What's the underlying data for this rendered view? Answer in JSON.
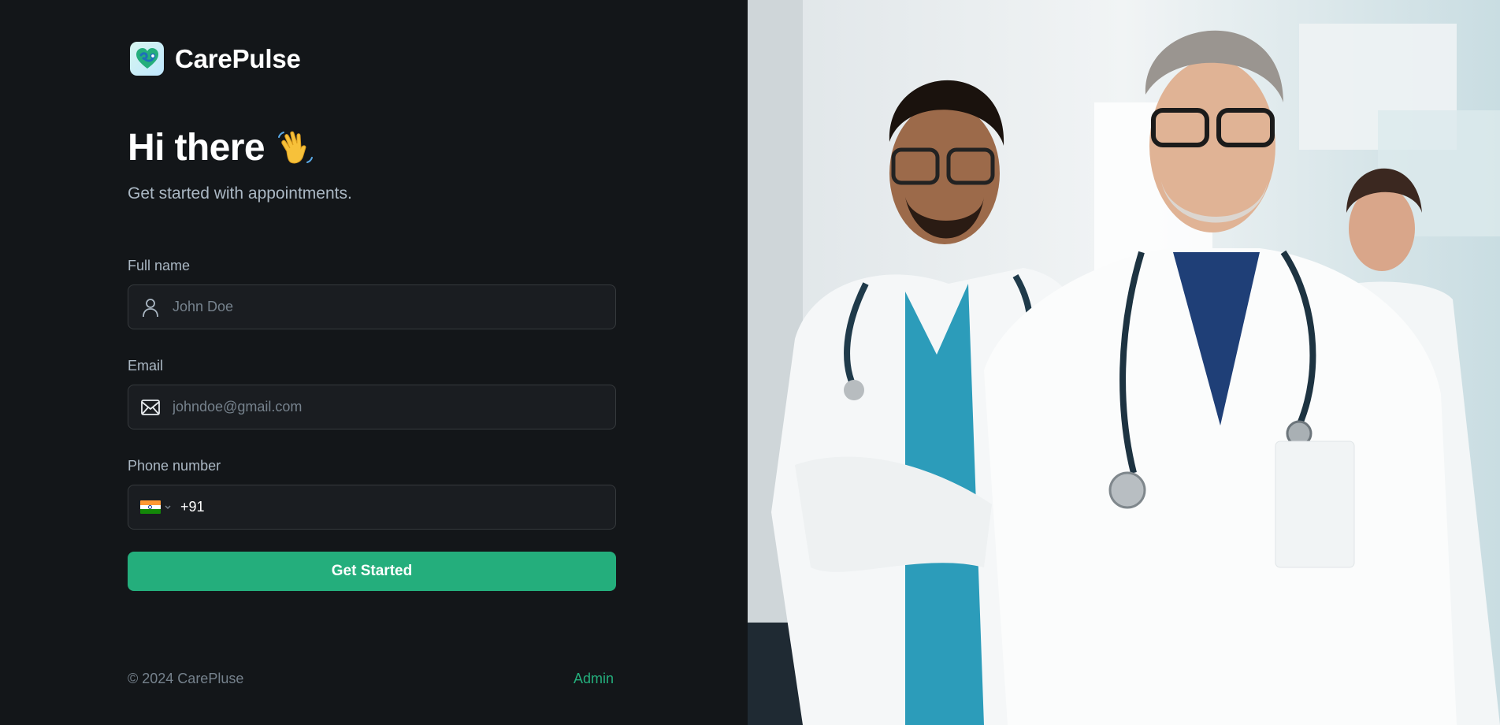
{
  "brand": {
    "name": "CarePulse",
    "logo_icon": "heart-stethoscope-icon"
  },
  "hero": {
    "title": "Hi there",
    "emoji_icon": "waving-hand-icon",
    "subtitle": "Get started with appointments."
  },
  "form": {
    "full_name": {
      "label": "Full name",
      "placeholder": "John Doe",
      "icon": "user-icon"
    },
    "email": {
      "label": "Email",
      "placeholder": "johndoe@gmail.com",
      "icon": "mail-icon"
    },
    "phone": {
      "label": "Phone number",
      "country_flag_icon": "india-flag-icon",
      "dial_code": "+91",
      "value": ""
    },
    "submit_label": "Get Started"
  },
  "footer": {
    "copyright": "© 2024 CarePluse",
    "admin_link": "Admin"
  },
  "side_image": {
    "description_icon": "doctors-photo"
  },
  "colors": {
    "background": "#131619",
    "accent": "#24ae7c",
    "input_bg": "#1a1d21",
    "input_border": "#363a3d",
    "muted_text": "#abb8c4"
  }
}
